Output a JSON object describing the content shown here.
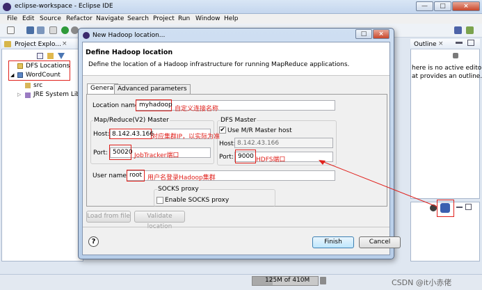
{
  "window": {
    "title": "eclipse-workspace - Eclipse IDE",
    "minimize": "—",
    "maximize": "□",
    "close": "×"
  },
  "menu": [
    "File",
    "Edit",
    "Source",
    "Refactor",
    "Navigate",
    "Search",
    "Project",
    "Run",
    "Window",
    "Help"
  ],
  "project_explorer": {
    "tab_label": "Project Explo...",
    "close": "×",
    "items": [
      {
        "label": "DFS Locations"
      },
      {
        "label": "WordCount"
      },
      {
        "label": "src"
      },
      {
        "label": "JRE System Libr..."
      }
    ]
  },
  "outline": {
    "tab_label": "Outline",
    "close": "×",
    "message_line1": "here is no active editor",
    "message_line2": "at provides an outline."
  },
  "dialog": {
    "title": "New Hadoop location...",
    "heading": "Define Hadoop location",
    "description": "Define the location of a Hadoop infrastructure for running MapReduce applications.",
    "tabs": [
      {
        "label": "General",
        "selected": true
      },
      {
        "label": "Advanced parameters",
        "selected": false
      }
    ],
    "location_name": {
      "label": "Location name:",
      "value": "myhadoop"
    },
    "mapreduce": {
      "title": "Map/Reduce(V2) Master",
      "host_label": "Host:",
      "host_value": "8.142.43.166",
      "port_label": "Port:",
      "port_value": "50020"
    },
    "dfs": {
      "title": "DFS Master",
      "use_mr_label": "Use M/R Master host",
      "use_mr_checked": true,
      "host_label": "Host:",
      "host_value": "8.142.43.166",
      "port_label": "Port:",
      "port_value": "9000"
    },
    "user": {
      "label": "User name:",
      "value": "root"
    },
    "socks": {
      "title": "SOCKS proxy",
      "enable_label": "Enable SOCKS proxy",
      "checked": false
    },
    "buttons": {
      "load": "Load from file",
      "validate": "Validate location",
      "finish": "Finish",
      "cancel": "Cancel",
      "help": "?"
    }
  },
  "annotations": {
    "location": "自定义连接名称",
    "host": "对应集群IP，以实际为准",
    "jobtracker": "JobTracker端口",
    "hdfs": "HDFS端口",
    "user": "用户名登录Hadoop集群"
  },
  "status": {
    "heap": "125M of 410M",
    "heap_used_fraction": 0.305
  },
  "watermark": "CSDN @it小赤佬",
  "colors": {
    "annotation_red": "#e0201b",
    "dialog_frame": "#b7cde8",
    "eclipse_purple": "#3b2a6d"
  }
}
